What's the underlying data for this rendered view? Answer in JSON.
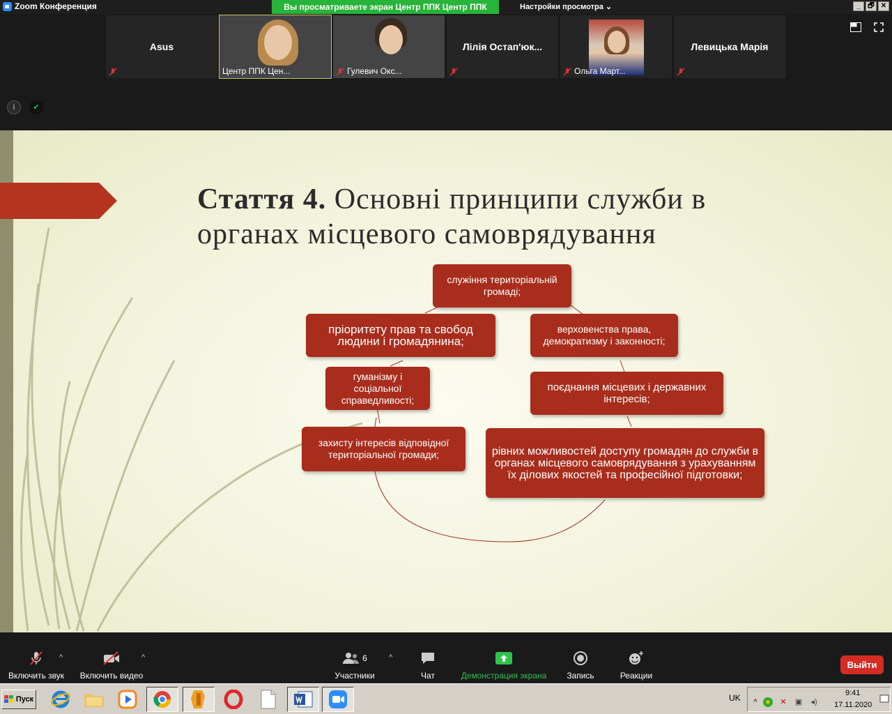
{
  "window": {
    "title": "Zoom Конференция",
    "share_banner": "Вы просматриваете экран Центр ППК Центр ППК",
    "view_settings": "Настройки просмотра",
    "view_settings_caret": "⌄",
    "controls": [
      "_",
      "🗗",
      "✕"
    ]
  },
  "participants": [
    {
      "name": "Asus",
      "video": false,
      "muted": true
    },
    {
      "name": "Центр ППК Цен...",
      "video": true,
      "muted": false,
      "active": true
    },
    {
      "name": "Гулевич Окс...",
      "video": true,
      "muted": true
    },
    {
      "name": "Лілія  Остап'юк...",
      "video": false,
      "muted": true
    },
    {
      "name": "Ольга Март...",
      "video": true,
      "muted": true
    },
    {
      "name": "Левицька Марія",
      "video": false,
      "muted": true
    }
  ],
  "strip_icons": {
    "info": "i",
    "shield": "✔"
  },
  "slide": {
    "title_bold": "Стаття 4.",
    "title_rest": " Основні принципи служби в органах місцевого самоврядування",
    "boxes": [
      "служіння територіальній громаді;",
      "пріоритету прав та свобод людини і громадянина;",
      "верховенства права, демократизму і законності;",
      "гуманізму і соціальної справедливості;",
      "поєднання місцевих і державних інтересів;",
      "захисту інтересів відповідної територіальної громади;",
      "рівних можливостей доступу громадян до служби в органах місцевого самоврядування  з урахуванням їх ділових якостей та професійної підготовки;"
    ]
  },
  "toolbar": {
    "mute_label": "Включить звук",
    "video_label": "Включить видео",
    "participants_label": "Участники",
    "participants_count": "6",
    "chat_label": "Чат",
    "share_label": "Демонстрация экрана",
    "record_label": "Запись",
    "reactions_label": "Реакции",
    "leave_label": "Выйти",
    "caret": "^"
  },
  "taskbar": {
    "start_label": "Пуск",
    "apps": [
      "internet-explorer",
      "file-explorer",
      "media-player",
      "chrome",
      "app-orange",
      "opera",
      "document",
      "word",
      "zoom"
    ],
    "language": "UK",
    "time": "9:41",
    "date": "17.11.2020"
  },
  "colors": {
    "accent_red": "#a82d1c",
    "share_green": "#28b33a",
    "leave_red": "#d32c25",
    "zoom_blue": "#2d8cff"
  }
}
